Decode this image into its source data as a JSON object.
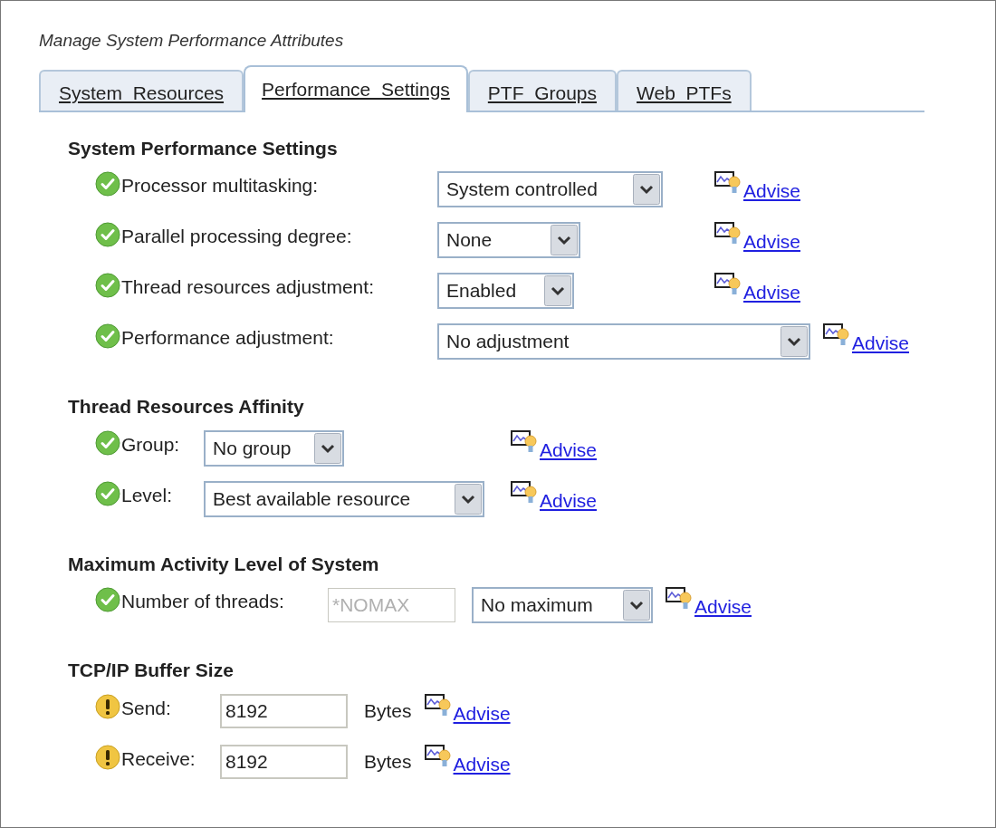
{
  "title": "Manage System Performance Attributes",
  "tabs": [
    {
      "label": "System  Resources",
      "selected": false
    },
    {
      "label": "Performance  Settings",
      "selected": true
    },
    {
      "label": "PTF  Groups",
      "selected": false
    },
    {
      "label": "Web  PTFs",
      "selected": false
    }
  ],
  "sections": [
    {
      "title": "System Performance Settings",
      "rows": [
        {
          "kind": "ok",
          "label": "Processor multitasking:",
          "select": {
            "value": "System controlled"
          },
          "advise": "Advise"
        },
        {
          "kind": "ok",
          "label": "Parallel processing degree:",
          "select": {
            "value": "None"
          },
          "advise": "Advise"
        },
        {
          "kind": "ok",
          "label": "Thread resources adjustment:",
          "select": {
            "value": "Enabled"
          },
          "advise": "Advise"
        },
        {
          "kind": "ok",
          "label": "Performance adjustment:",
          "select": {
            "value": "No adjustment"
          },
          "advise": "Advise"
        }
      ]
    },
    {
      "title": "Thread Resources Affinity",
      "rows": [
        {
          "kind": "ok",
          "label": "Group:",
          "select": {
            "value": "No group"
          },
          "advise": "Advise"
        },
        {
          "kind": "ok",
          "label": "Level:",
          "select": {
            "value": "Best available resource"
          },
          "advise": "Advise"
        }
      ]
    },
    {
      "title": "Maximum Activity Level of System",
      "rows": [
        {
          "kind": "ok",
          "label": "Number of threads:",
          "input": {
            "value": "*NOMAX",
            "disabled": true
          },
          "select": {
            "value": "No maximum"
          },
          "advise": "Advise"
        }
      ]
    },
    {
      "title": "TCP/IP Buffer Size",
      "rows": [
        {
          "kind": "warning",
          "label": "Send:",
          "input": {
            "value": "8192",
            "disabled": false
          },
          "unit": "Bytes",
          "advise": "Advise"
        },
        {
          "kind": "warning",
          "label": "Receive:",
          "input": {
            "value": "8192",
            "disabled": false
          },
          "unit": "Bytes",
          "advise": "Advise"
        }
      ]
    }
  ]
}
